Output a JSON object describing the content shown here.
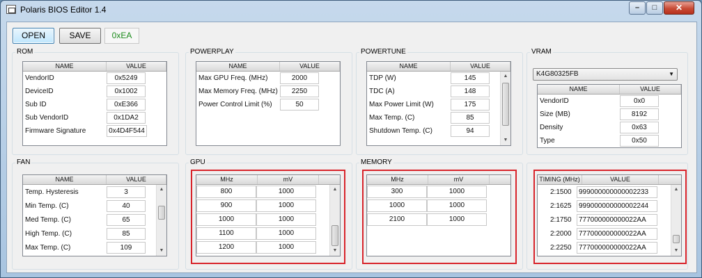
{
  "window": {
    "title": "Polaris BIOS Editor 1.4",
    "minimize": "–",
    "maximize": "□",
    "close": "✕"
  },
  "toolbar": {
    "open": "OPEN",
    "save": "SAVE",
    "checksum": "0xEA"
  },
  "rom": {
    "label": "ROM",
    "col_name": "NAME",
    "col_value": "VALUE",
    "rows": [
      {
        "name": "VendorID",
        "value": "0x5249"
      },
      {
        "name": "DeviceID",
        "value": "0x1002"
      },
      {
        "name": "Sub ID",
        "value": "0xE366"
      },
      {
        "name": "Sub VendorID",
        "value": "0x1DA2"
      },
      {
        "name": "Firmware Signature",
        "value": "0x4D4F544"
      }
    ]
  },
  "powerplay": {
    "label": "POWERPLAY",
    "col_name": "NAME",
    "col_value": "VALUE",
    "rows": [
      {
        "name": "Max GPU Freq. (MHz)",
        "value": "2000"
      },
      {
        "name": "Max Memory Freq. (MHz)",
        "value": "2250"
      },
      {
        "name": "Power Control Limit (%)",
        "value": "50"
      }
    ]
  },
  "powertune": {
    "label": "POWERTUNE",
    "col_name": "NAME",
    "col_value": "VALUE",
    "rows": [
      {
        "name": "TDP (W)",
        "value": "145"
      },
      {
        "name": "TDC (A)",
        "value": "148"
      },
      {
        "name": "Max Power Limit (W)",
        "value": "175"
      },
      {
        "name": "Max Temp. (C)",
        "value": "85"
      },
      {
        "name": "Shutdown Temp. (C)",
        "value": "94"
      }
    ]
  },
  "vram": {
    "label": "VRAM",
    "selected": "K4G80325FB",
    "col_name": "NAME",
    "col_value": "VALUE",
    "rows": [
      {
        "name": "VendorID",
        "value": "0x0"
      },
      {
        "name": "Size (MB)",
        "value": "8192"
      },
      {
        "name": "Density",
        "value": "0x63"
      },
      {
        "name": "Type",
        "value": "0x50"
      }
    ]
  },
  "fan": {
    "label": "FAN",
    "col_name": "NAME",
    "col_value": "VALUE",
    "rows": [
      {
        "name": "Temp. Hysteresis",
        "value": "3"
      },
      {
        "name": "Min Temp. (C)",
        "value": "40"
      },
      {
        "name": "Med Temp. (C)",
        "value": "65"
      },
      {
        "name": "High Temp. (C)",
        "value": "85"
      },
      {
        "name": "Max Temp. (C)",
        "value": "109"
      }
    ]
  },
  "gpu": {
    "label": "GPU",
    "col_mhz": "MHz",
    "col_mv": "mV",
    "rows": [
      {
        "mhz": "800",
        "mv": "1000"
      },
      {
        "mhz": "900",
        "mv": "1000"
      },
      {
        "mhz": "1000",
        "mv": "1000"
      },
      {
        "mhz": "1100",
        "mv": "1000"
      },
      {
        "mhz": "1200",
        "mv": "1000"
      }
    ]
  },
  "memory": {
    "label": "MEMORY",
    "col_mhz": "MHz",
    "col_mv": "mV",
    "rows": [
      {
        "mhz": "300",
        "mv": "1000"
      },
      {
        "mhz": "1000",
        "mv": "1000"
      },
      {
        "mhz": "2100",
        "mv": "1000"
      }
    ]
  },
  "timing": {
    "col_mhz": "TIMING (MHz)",
    "col_value": "VALUE",
    "rows": [
      {
        "mhz": "2:1500",
        "value": "999000000000002233"
      },
      {
        "mhz": "2:1625",
        "value": "999000000000002244"
      },
      {
        "mhz": "2:1750",
        "value": "777000000000022AA"
      },
      {
        "mhz": "2:2000",
        "value": "777000000000022AA"
      },
      {
        "mhz": "2:2250",
        "value": "777000000000022AA"
      }
    ]
  },
  "colors": {
    "highlight": "#d8232a",
    "checksum_text": "#1a8a1a"
  }
}
